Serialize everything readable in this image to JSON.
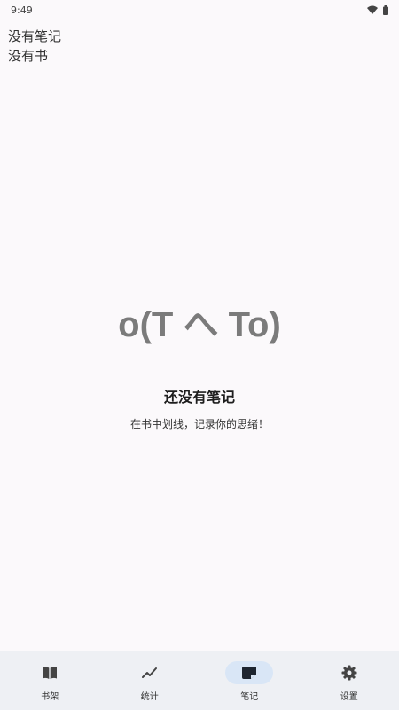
{
  "status_bar": {
    "time": "9:49",
    "icons": [
      "wifi-icon",
      "battery-icon"
    ]
  },
  "top_text": {
    "line1": "没有笔记",
    "line2": "没有书"
  },
  "empty_state": {
    "emoticon": "o(T へ To)",
    "title": "还没有笔记",
    "subtitle": "在书中划线，记录你的思绪！"
  },
  "nav": {
    "active": "notes",
    "items": [
      {
        "id": "bookshelf",
        "label": "书架",
        "icon": "book-open-icon"
      },
      {
        "id": "stats",
        "label": "统计",
        "icon": "trend-line-icon"
      },
      {
        "id": "notes",
        "label": "笔记",
        "icon": "note-icon"
      },
      {
        "id": "settings",
        "label": "设置",
        "icon": "gear-icon"
      }
    ]
  },
  "colors": {
    "background": "#fbf9fb",
    "nav_background": "#eef0f4",
    "nav_active_pill": "#d9e6f6",
    "emoticon": "#7b7b7b"
  }
}
